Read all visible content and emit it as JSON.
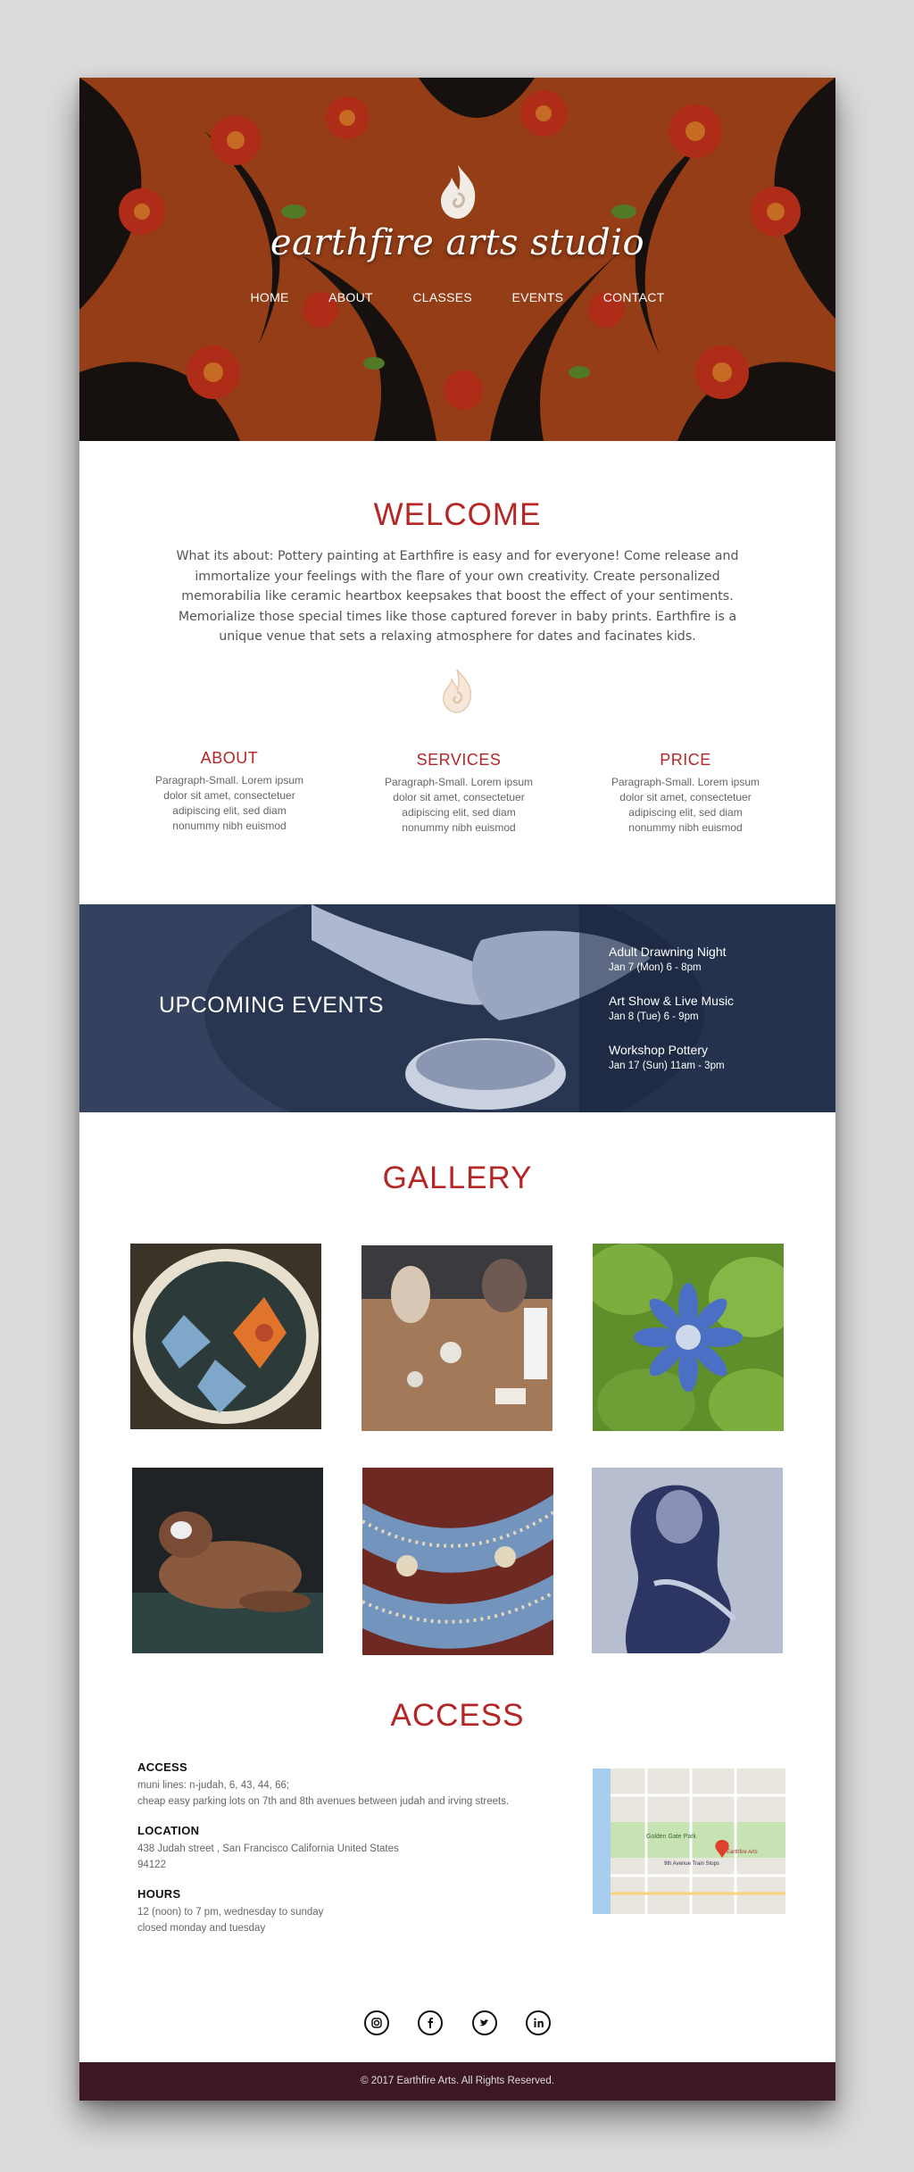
{
  "brand": "earthfire arts studio",
  "nav": [
    "HOME",
    "ABOUT",
    "CLASSES",
    "EVENTS",
    "CONTACT"
  ],
  "welcome": {
    "title": "WELCOME",
    "text": "What its about: Pottery painting at Earthfire is easy and for everyone! Come release and immortalize your feelings with the flare of your own creativity. Create personalized memorabilia like ceramic heartbox keepsakes that boost the effect of your sentiments. Memorialize those special times like those captured forever in baby prints. Earthfire is a unique venue that sets a relaxing atmosphere for dates and facinates kids."
  },
  "columns": [
    {
      "title": "ABOUT",
      "text": "Paragraph-Small. Lorem ipsum dolor sit amet, consectetuer adipiscing elit, sed diam nonummy nibh euismod"
    },
    {
      "title": "SERVICES",
      "text": "Paragraph-Small. Lorem ipsum dolor sit amet, consectetuer adipiscing elit, sed diam nonummy nibh euismod"
    },
    {
      "title": "PRICE",
      "text": "Paragraph-Small. Lorem ipsum dolor sit amet, consectetuer adipiscing elit, sed diam nonummy nibh euismod"
    }
  ],
  "events": {
    "title": "UPCOMING EVENTS",
    "items": [
      {
        "name": "Adult Drawning Night",
        "date": "Jan 7 (Mon) 6 - 8pm"
      },
      {
        "name": "Art Show & Live Music",
        "date": "Jan 8 (Tue) 6 - 9pm"
      },
      {
        "name": "Workshop Pottery",
        "date": "Jan 17 (Sun) 11am - 3pm"
      }
    ]
  },
  "gallery": {
    "title": "GALLERY",
    "images": [
      "painted-flower-plate",
      "pottery-class-table",
      "blue-ceramic-flower",
      "dog-resting",
      "patterned-tile-art",
      "figure-sketch"
    ]
  },
  "access": {
    "title": "ACCESS",
    "blocks": [
      {
        "heading": "ACCESS",
        "lines": [
          "muni lines: n-judah, 6, 43, 44, 66;",
          "cheap easy parking lots on 7th and 8th avenues between judah and irving streets."
        ]
      },
      {
        "heading": "LOCATION",
        "lines": [
          "438 Judah street , San Francisco California United States",
          "94122"
        ]
      },
      {
        "heading": "HOURS",
        "lines": [
          "12 (noon) to 7 pm, wednesday to sunday",
          "closed monday and tuesday"
        ]
      }
    ],
    "map_labels": [
      "Golden Gate Park",
      "Earthfire Arts",
      "9th Avenue Train Stops"
    ]
  },
  "social": [
    "instagram-icon",
    "facebook-icon",
    "twitter-icon",
    "linkedin-icon"
  ],
  "footer": "© 2017 Earthfire Arts. All Rights Reserved.",
  "colors": {
    "accent": "#b52727",
    "footer_bg": "#3d1724",
    "page_bg": "#dcdcdc"
  }
}
